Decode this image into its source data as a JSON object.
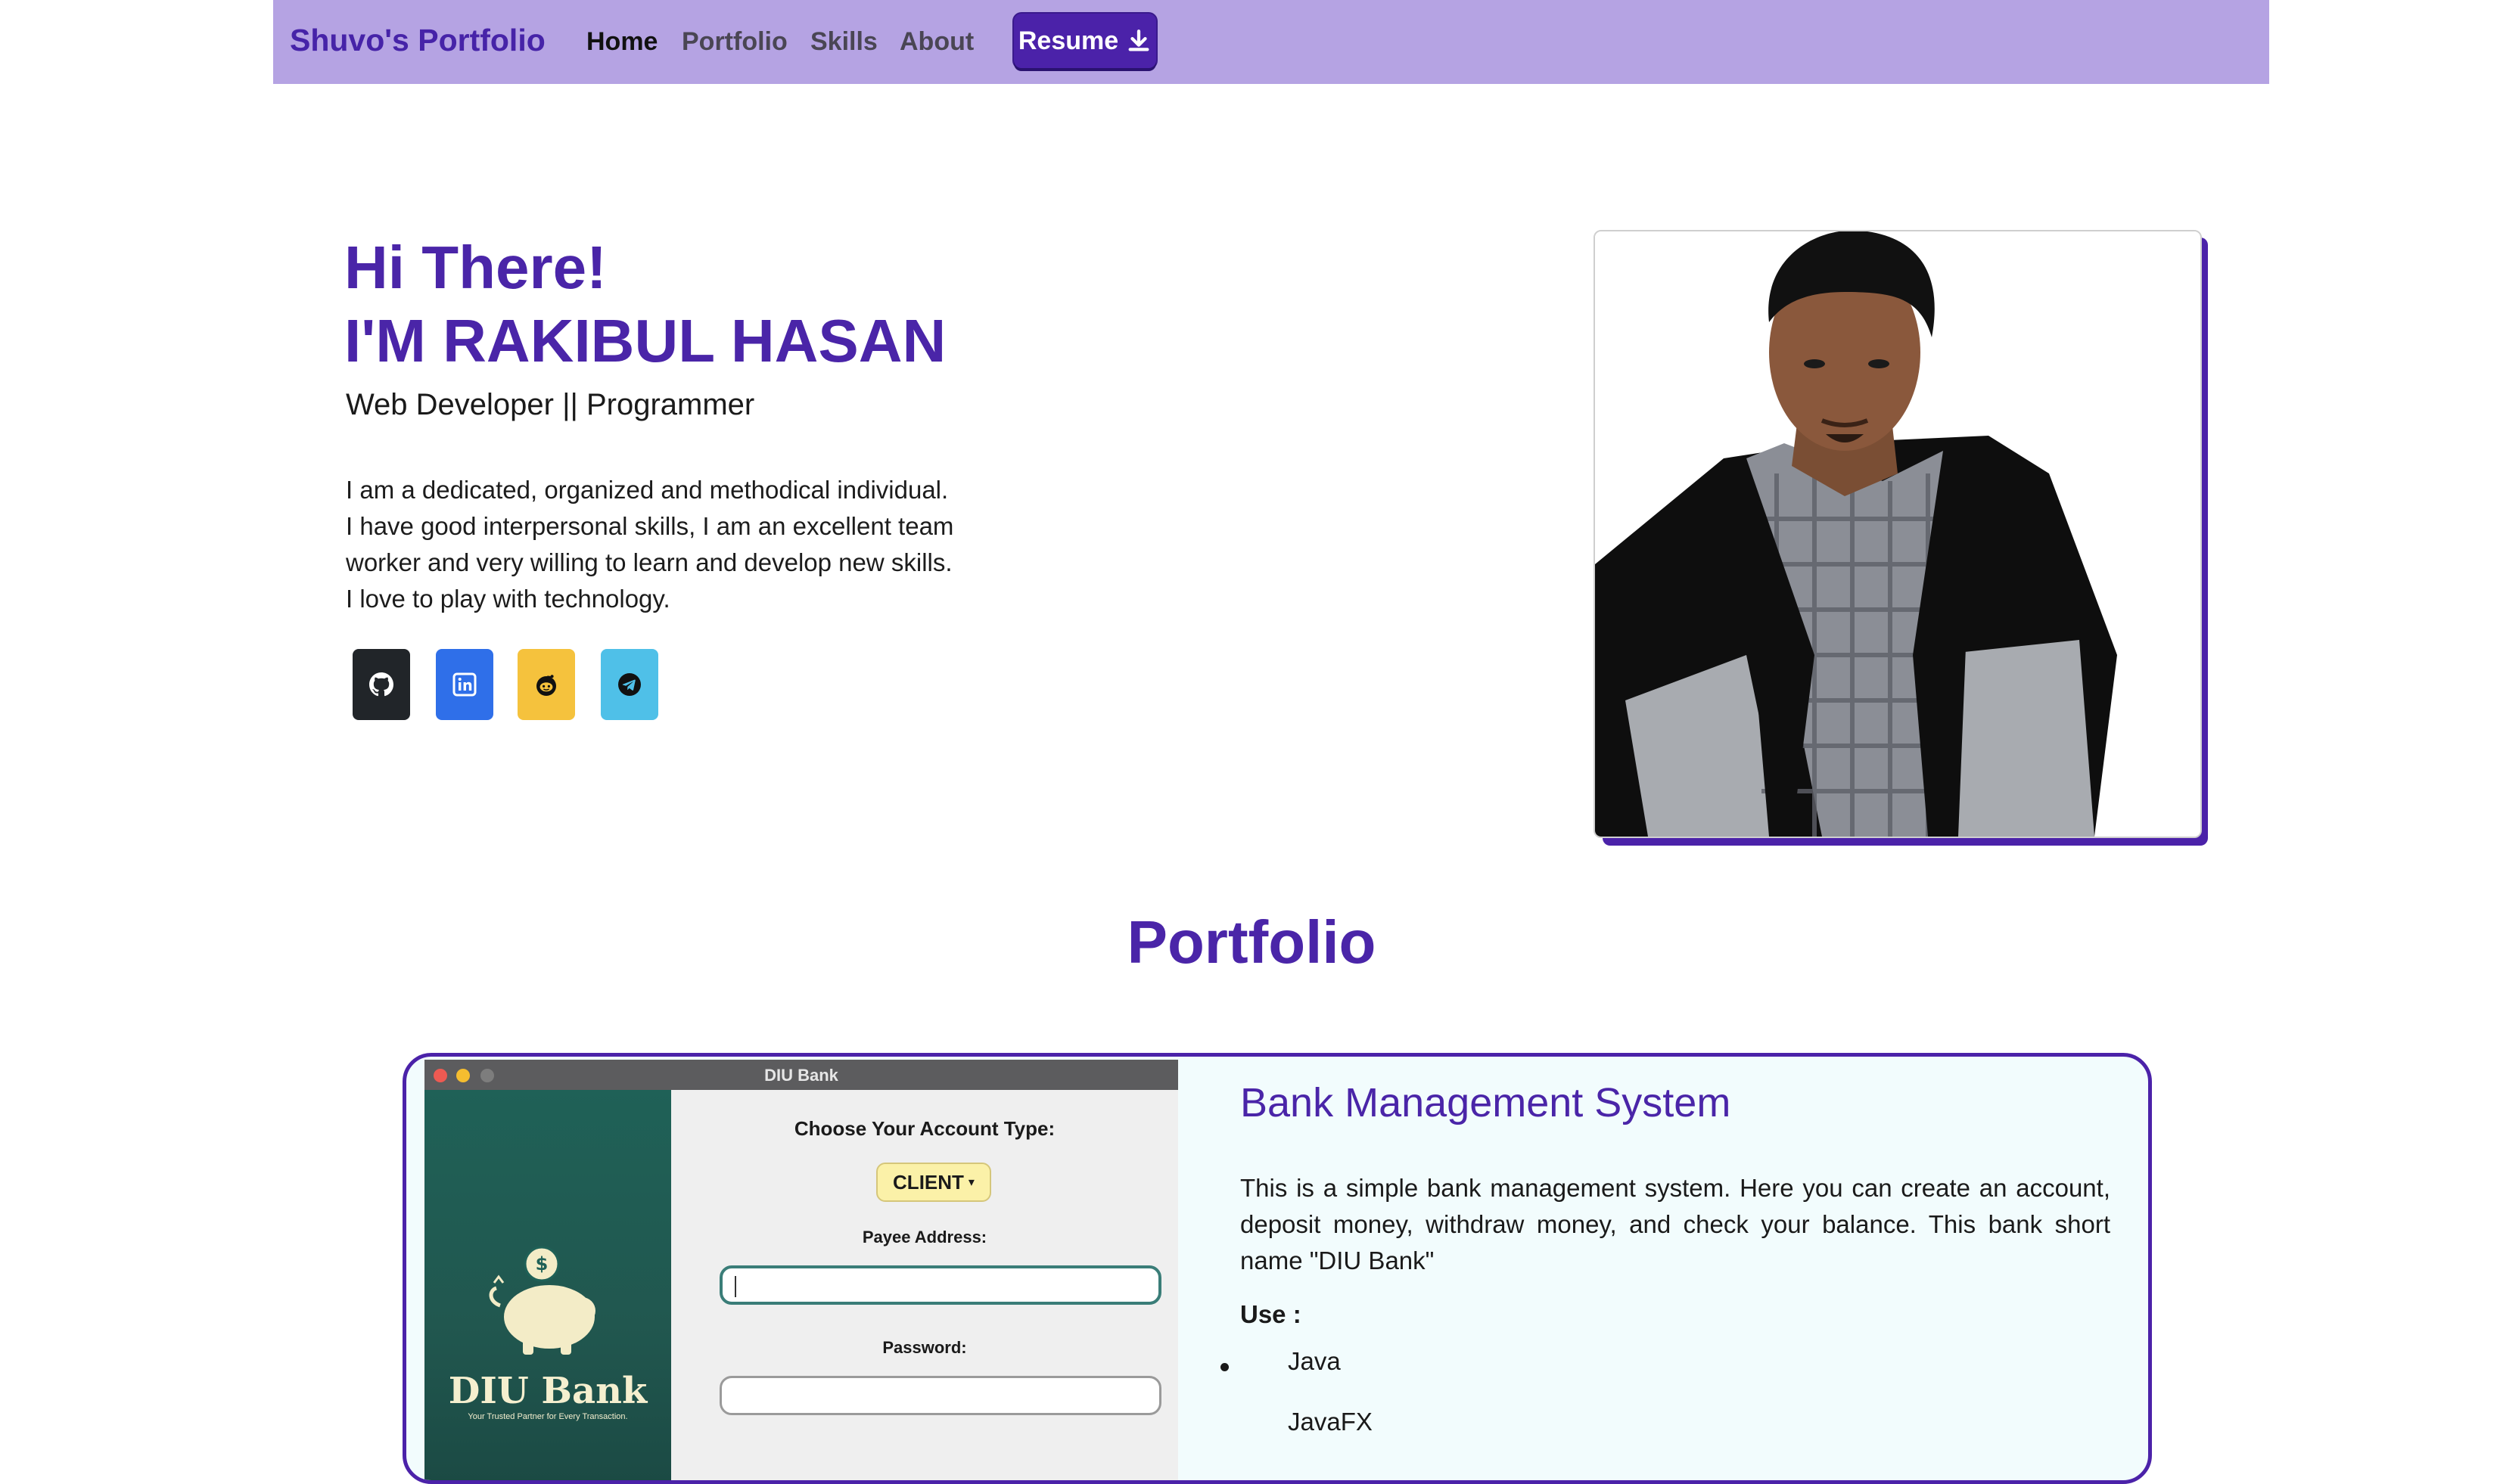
{
  "navbar": {
    "brand": "Shuvo's Portfolio",
    "links": [
      {
        "label": "Home",
        "active": true
      },
      {
        "label": "Portfolio",
        "active": false
      },
      {
        "label": "Skills",
        "active": false
      },
      {
        "label": "About",
        "active": false
      }
    ],
    "resume_label": "Resume",
    "resume_icon": "download-icon",
    "bg_color": "#b5a3e3",
    "accent_color": "#4b22a9"
  },
  "hero": {
    "greeting": "Hi There!",
    "name": "I'M RAKIBUL HASAN",
    "role": "Web Developer || Programmer",
    "bio_lines": [
      "I am a dedicated, organized and methodical individual.",
      "I have good interpersonal skills, I am an excellent team",
      "worker and very willing to learn and develop new skills.",
      "I love to play with technology."
    ],
    "socials": [
      {
        "icon": "github-icon",
        "color": "#212529"
      },
      {
        "icon": "linkedin-icon",
        "color": "#2f6fe9"
      },
      {
        "icon": "reddit-icon",
        "color": "#f5c23d"
      },
      {
        "icon": "telegram-icon",
        "color": "#4fc0e8"
      }
    ],
    "photo": "profile-photo"
  },
  "portfolio": {
    "title": "Portfolio",
    "project": {
      "screenshot": {
        "window_title": "DIU Bank",
        "logo_text": "DIU Bank",
        "tagline": "Your Trusted Partner for Every Transaction.",
        "account_type_label": "Choose Your Account Type:",
        "account_type_value": "CLIENT",
        "payee_label": "Payee Address:",
        "payee_value": "",
        "password_label": "Password:",
        "password_value": ""
      },
      "title": "Bank Management System",
      "description": "This is a simple bank management system. Here you can create an account, deposit money, withdraw money, and check your balance. This bank short name \"DIU Bank\"",
      "use_label": "Use :",
      "technologies": [
        "Java",
        "JavaFX"
      ]
    }
  }
}
